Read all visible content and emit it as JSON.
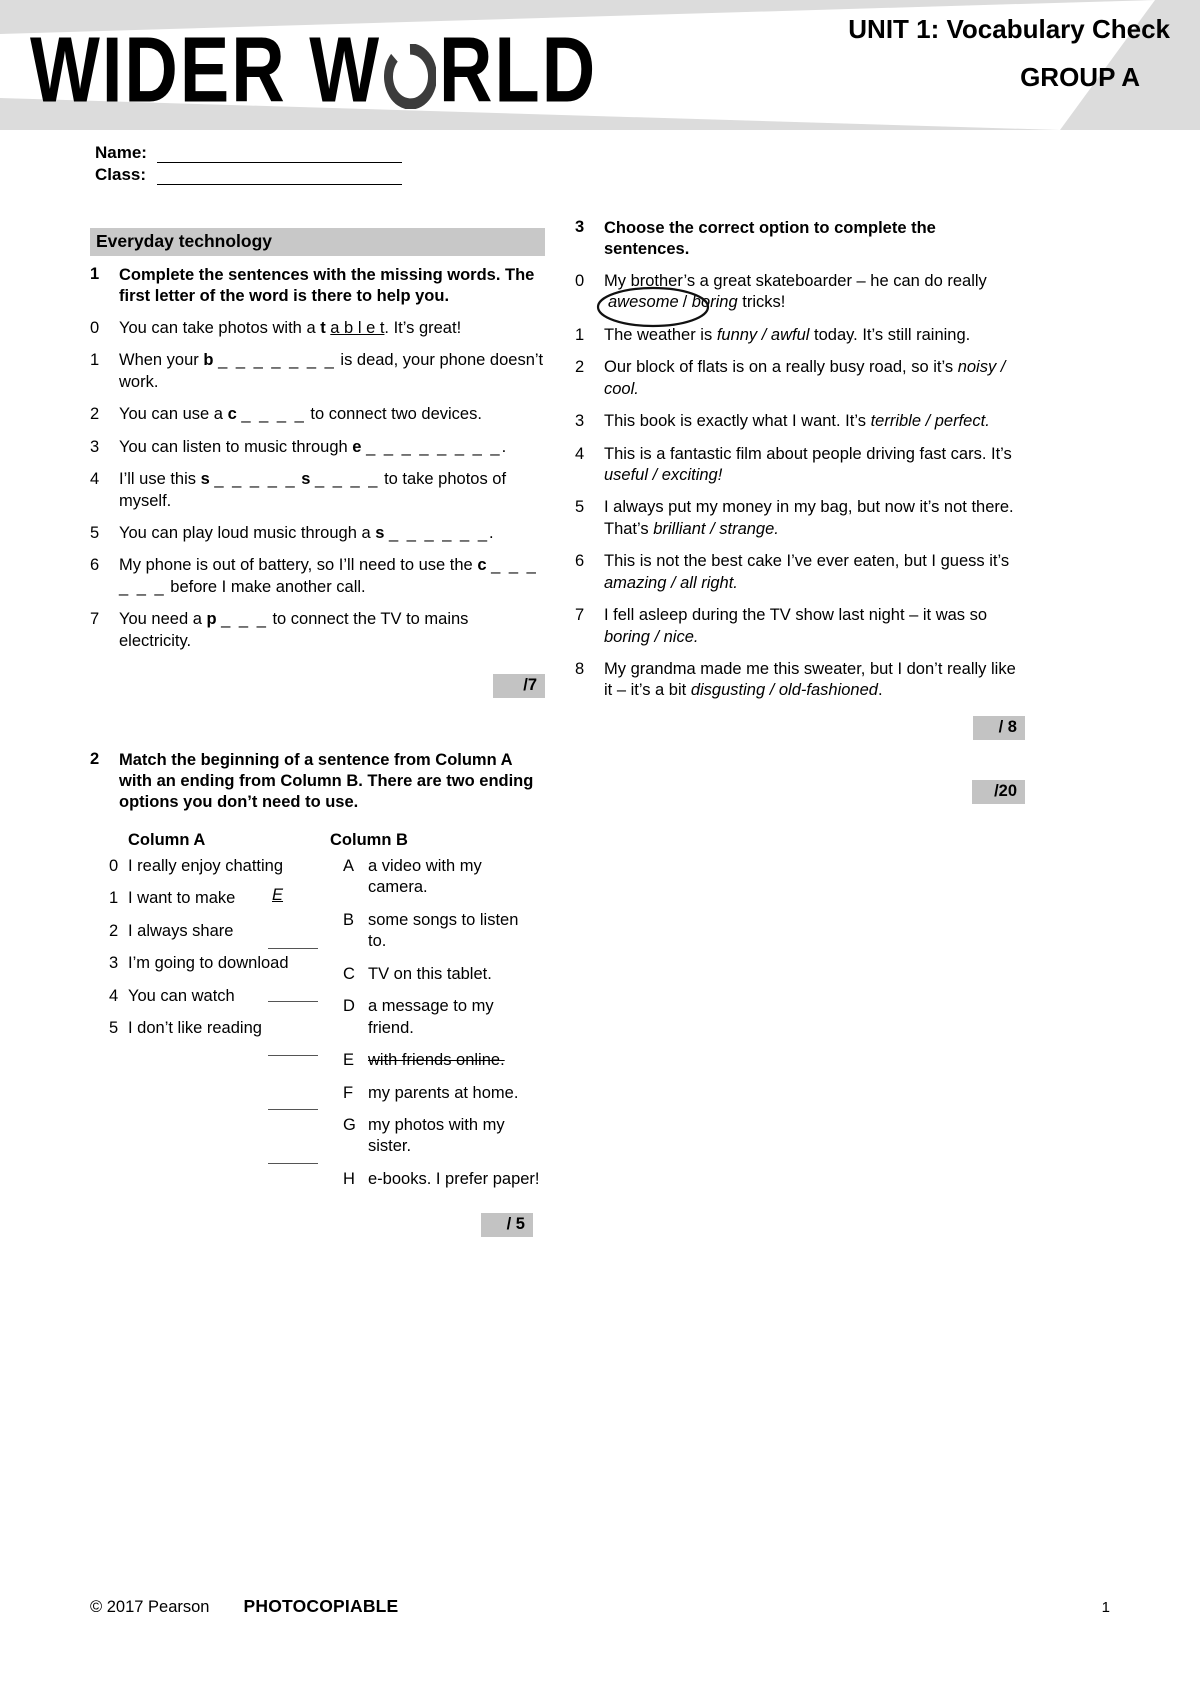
{
  "header": {
    "logo_text_1": "WIDER W",
    "logo_icon": "globe-ring-icon",
    "logo_text_2": "RLD",
    "unit_title": "UNIT 1: Vocabulary Check",
    "group_title": "GROUP A",
    "banner_bg": "#dcdcdc"
  },
  "identity": {
    "name_label": "Name:",
    "class_label": "Class:"
  },
  "left": {
    "section_heading": "Everyday technology",
    "task1": {
      "number": "1",
      "instruction": "Complete the sentences with the missing words. The first letter of the word is there to help you.",
      "items": [
        {
          "n": "0",
          "pre": "You can take photos with a ",
          "letter": "t",
          "answer": "a b l e t",
          "post": ". It’s great!"
        },
        {
          "n": "1",
          "pre": "When your ",
          "letter": "b",
          "blank": "_ _ _ _ _ _ _",
          "post": " is dead, your phone doesn’t work."
        },
        {
          "n": "2",
          "pre": "You can use a ",
          "letter": "c",
          "blank": "_ _ _ _",
          "post": " to connect two devices."
        },
        {
          "n": "3",
          "pre": "You can listen to music through ",
          "letter": "e",
          "blank": "_ _ _ _ _ _ _ _",
          "post": "."
        },
        {
          "n": "4",
          "pre": "I’ll use this ",
          "letter": "s",
          "blank": "_ _ _ _ _",
          "letter2": "s",
          "blank2": "_ _ _ _",
          "post": " to take photos of myself."
        },
        {
          "n": "5",
          "pre": "You can play loud music through a ",
          "letter": "s",
          "blank": "_ _ _ _ _ _",
          "post": "."
        },
        {
          "n": "6",
          "pre": "My phone is out of battery, so I’ll need to use the ",
          "letter": "c",
          "blank": "_ _ _ _ _ _",
          "post": " before I make another call."
        },
        {
          "n": "7",
          "pre": "You need a ",
          "letter": "p",
          "blank": "_ _ _",
          "post": " to connect the TV to mains electricity."
        }
      ],
      "score": "/7"
    },
    "task2": {
      "number": "2",
      "instruction": "Match the beginning of a sentence from Column A with an ending from Column B. There are two ending options you don’t need to use.",
      "column_a_heading": "Column A",
      "column_b_heading": "Column B",
      "column_a": [
        {
          "n": "0",
          "text": "I really enjoy chatting",
          "answer": "E"
        },
        {
          "n": "1",
          "text": "I want to make",
          "answer": ""
        },
        {
          "n": "2",
          "text": "I always share",
          "answer": ""
        },
        {
          "n": "3",
          "text": "I’m going to download",
          "answer": ""
        },
        {
          "n": "4",
          "text": "You can watch",
          "answer": ""
        },
        {
          "n": "5",
          "text": "I don’t like reading",
          "answer": ""
        }
      ],
      "column_b": [
        {
          "k": "A",
          "text": "a video with my camera.",
          "used": false
        },
        {
          "k": "B",
          "text": "some songs to listen to.",
          "used": false
        },
        {
          "k": "C",
          "text": "TV on this tablet.",
          "used": false
        },
        {
          "k": "D",
          "text": " a message to my friend.",
          "used": false
        },
        {
          "k": "E",
          "text": "with friends online.",
          "used": true
        },
        {
          "k": "F",
          "text": "my parents at home.",
          "used": false
        },
        {
          "k": "G",
          "text": "my photos with my sister.",
          "used": false
        },
        {
          "k": "H",
          "text": "e-books. I prefer paper!",
          "used": false
        }
      ],
      "score": "/ 5"
    }
  },
  "right": {
    "task3": {
      "number": "3",
      "instruction": "Choose the correct option to complete the sentences.",
      "items": [
        {
          "n": "0",
          "pre": "My brother’s a great skateboarder – he can do really ",
          "opt1": "awesome",
          "sep": "/ ",
          "opt2": "boring",
          "post": " tricks!",
          "circled": "opt1"
        },
        {
          "n": "1",
          "pre": "The weather is ",
          "opt1": "funny / awful",
          "post": " today. It’s still raining."
        },
        {
          "n": "2",
          "pre": "Our block of flats is on a really busy road, so it’s ",
          "opt1": "noisy / cool.",
          "post": ""
        },
        {
          "n": "3",
          "pre": "This book is exactly what I want. It’s ",
          "opt1": "terrible / perfect.",
          "post": ""
        },
        {
          "n": "4",
          "pre": "This is a fantastic film about people driving fast cars. It’s ",
          "opt1": "useful / exciting!",
          "post": ""
        },
        {
          "n": "5",
          "pre": "I always put my money in my bag, but now it’s not there. That’s ",
          "opt1": "brilliant / strange.",
          "post": ""
        },
        {
          "n": "6",
          "pre": "This is not the best cake I’ve ever eaten, but I guess it’s ",
          "opt1": "amazing / all right.",
          "post": ""
        },
        {
          "n": "7",
          "pre": "I fell asleep during the TV show last night – it was so ",
          "opt1": "boring / nice.",
          "post": ""
        },
        {
          "n": "8",
          "pre": "My grandma made me this sweater, but I don’t really like it – it’s a bit ",
          "opt1": "disgusting / old-fashioned",
          "post": "."
        }
      ],
      "score": "/ 8"
    },
    "total_score": "/20"
  },
  "footer": {
    "copyright": "© 2017 Pearson",
    "photocopiable": "PHOTOCOPIABLE",
    "page_number": "1"
  }
}
